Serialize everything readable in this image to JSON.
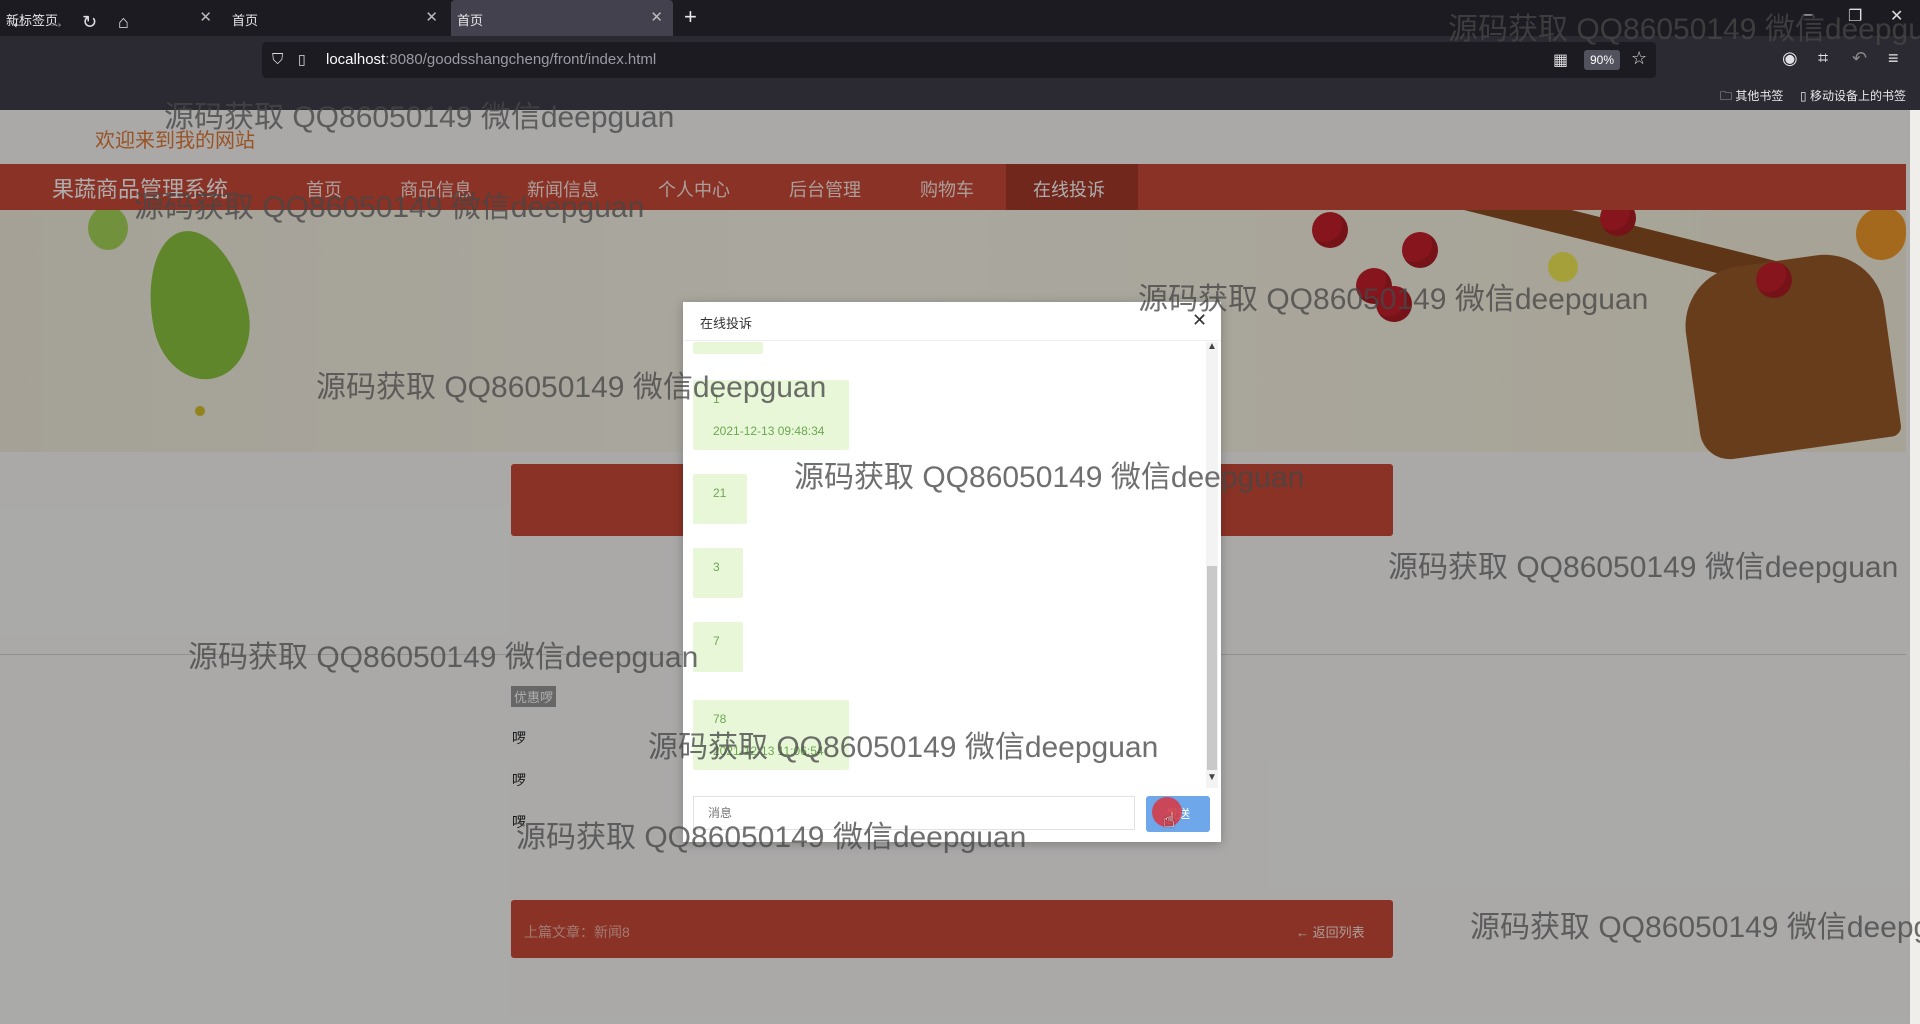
{
  "browser": {
    "tabs": [
      {
        "title": "新标签页"
      },
      {
        "title": "首页"
      },
      {
        "title": "首页"
      }
    ],
    "url_host": "localhost",
    "url_rest": ":8080/goodsshangcheng/front/index.html",
    "zoom": "90%",
    "bookmarks": [
      "其他书签",
      "移动设备上的书签"
    ]
  },
  "site": {
    "welcome": "欢迎来到我的网站",
    "brand": "果蔬商品管理系统",
    "nav": [
      "首页",
      "商品信息",
      "新闻信息",
      "个人中心",
      "后台管理",
      "购物车",
      "在线投诉"
    ],
    "active_nav": "在线投诉"
  },
  "article": {
    "tag": "优惠啰",
    "lines": [
      "啰",
      "啰",
      "啰"
    ],
    "prev_label": "上篇文章：新闻8",
    "back_label": "返回列表"
  },
  "dialog": {
    "title": "在线投诉",
    "messages": [
      {
        "text": "1",
        "time": "2021-12-13 09:48:34"
      },
      {
        "text": "21",
        "time": ""
      },
      {
        "text": "3",
        "time": ""
      },
      {
        "text": "7",
        "time": ""
      },
      {
        "text": "78",
        "time": "2021-12-13 11:06:54"
      }
    ],
    "input_placeholder": "消息",
    "send_label": "发送"
  },
  "watermark": "源码获取 QQ86050149 微信deepguan",
  "colors": {
    "nav_red": "#cc4a37",
    "nav_active": "#a93a2b",
    "bubble_bg": "#e9f7d9",
    "send_button": "#6ea8ea"
  }
}
